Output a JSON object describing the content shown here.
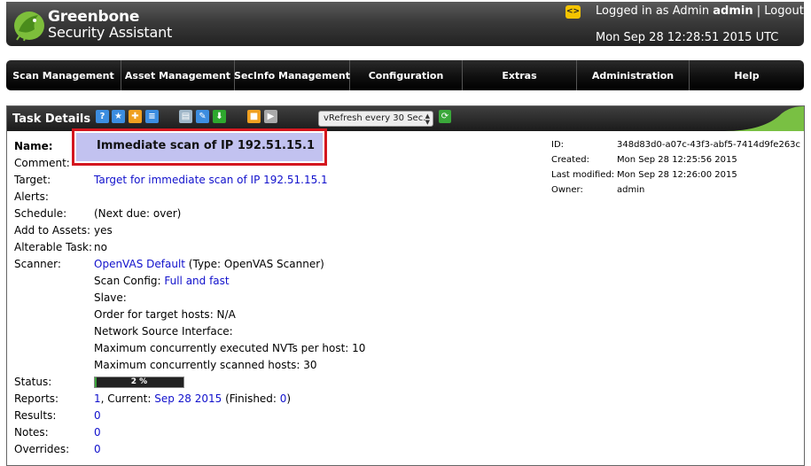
{
  "header": {
    "brand_line1": "Greenbone",
    "brand_line2": "Security Assistant",
    "logged_in_prefix": "Logged in as Admin ",
    "username": "admin",
    "separator": "|",
    "logout": "Logout",
    "datetime": "Mon Sep 28 12:28:51 2015 UTC",
    "icon_label": "<>"
  },
  "nav": [
    {
      "label": "Scan Management"
    },
    {
      "label": "Asset Management"
    },
    {
      "label": "SecInfo Management"
    },
    {
      "label": "Configuration"
    },
    {
      "label": "Extras"
    },
    {
      "label": "Administration"
    },
    {
      "label": "Help"
    }
  ],
  "task": {
    "title": "Task Details",
    "refresh_select": "vRefresh every 30 Sec.",
    "name_label": "Name:",
    "name_value": "Immediate scan of IP 192.51.15.1",
    "comment_label": "Comment:",
    "target_label": "Target:",
    "target_value": "Target for immediate scan of IP 192.51.15.1",
    "alerts_label": "Alerts:",
    "schedule_label": "Schedule:",
    "schedule_value": "(Next due: over)",
    "assets_label": "Add to Assets:",
    "assets_value": "yes",
    "alterable_label": "Alterable Task:",
    "alterable_value": "no",
    "scanner_label": "Scanner:",
    "scanner_link": "OpenVAS Default",
    "scanner_type": " (Type: OpenVAS Scanner)",
    "scan_config_prefix": "Scan Config: ",
    "scan_config_link": "Full and fast",
    "slave": "Slave:",
    "order": "Order for target hosts: N/A",
    "network_source": "Network Source Interface:",
    "max_nvts": "Maximum concurrently executed NVTs per host: 10",
    "max_hosts": "Maximum concurrently scanned hosts: 30",
    "status_label": "Status:",
    "status_text": "2 %",
    "status_progress": 0.02,
    "reports_label": "Reports:",
    "reports_count": "1",
    "reports_current_prefix": ", Current: ",
    "reports_current_link": "Sep 28 2015",
    "reports_finished_prefix": " (Finished: ",
    "reports_finished_link": "0",
    "reports_finished_suffix": ")",
    "results_label": "Results:",
    "results_value": "0",
    "notes_label": "Notes:",
    "notes_value": "0",
    "overrides_label": "Overrides:",
    "overrides_value": "0"
  },
  "meta": {
    "id_label": "ID:",
    "id_value": "348d83d0-a07c-43f3-abf5-7414d9fe263c",
    "created_label": "Created:",
    "created_value": "Mon Sep 28 12:25:56 2015",
    "modified_label": "Last modified:",
    "modified_value": "Mon Sep 28 12:26:00 2015",
    "owner_label": "Owner:",
    "owner_value": "admin"
  },
  "colors": {
    "highlight_border": "#d4171f",
    "highlight_fill": "#c2c2f0",
    "link": "#1111cc",
    "progress": "#3ca63c"
  }
}
